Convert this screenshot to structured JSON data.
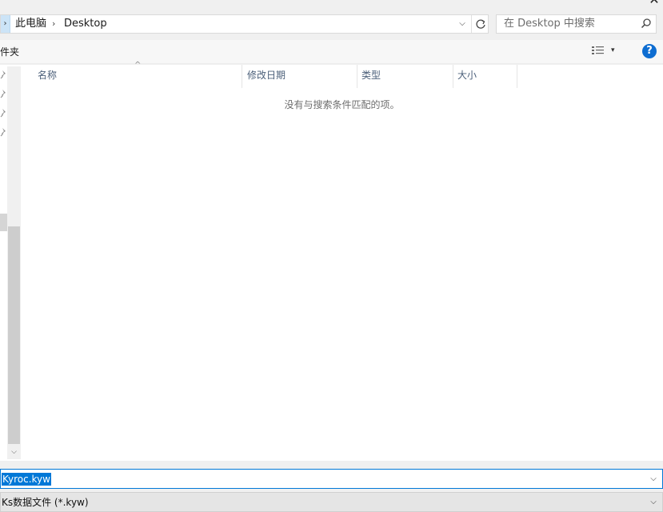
{
  "window": {
    "close_glyph": "✕"
  },
  "address_bar": {
    "crumbs": [
      "此电脑",
      "Desktop"
    ],
    "separator": "›",
    "left_arrow": "›",
    "dropdown_glyph": "⌵"
  },
  "search": {
    "placeholder": "在 Desktop 中搜索"
  },
  "toolbar": {
    "left_label": "件夹",
    "view_dropdown": "▾",
    "help": "?"
  },
  "columns": [
    "名称",
    "修改日期",
    "类型",
    "大小"
  ],
  "sort_indicator": "^",
  "empty_message": "没有与搜索条件匹配的项。",
  "nav_pane": {
    "pin_glyph": "📌",
    "pin_count": 4,
    "scroll_down": "⌵"
  },
  "file_name": {
    "value": "Kyroc.kyw",
    "dropdown": "⌵"
  },
  "file_type": {
    "value": "Ks数据文件 (*.kyw)",
    "dropdown": "⌵"
  },
  "colors": {
    "accent": "#0078d7",
    "help": "#0e6dd1",
    "header_text": "#4c607a"
  }
}
